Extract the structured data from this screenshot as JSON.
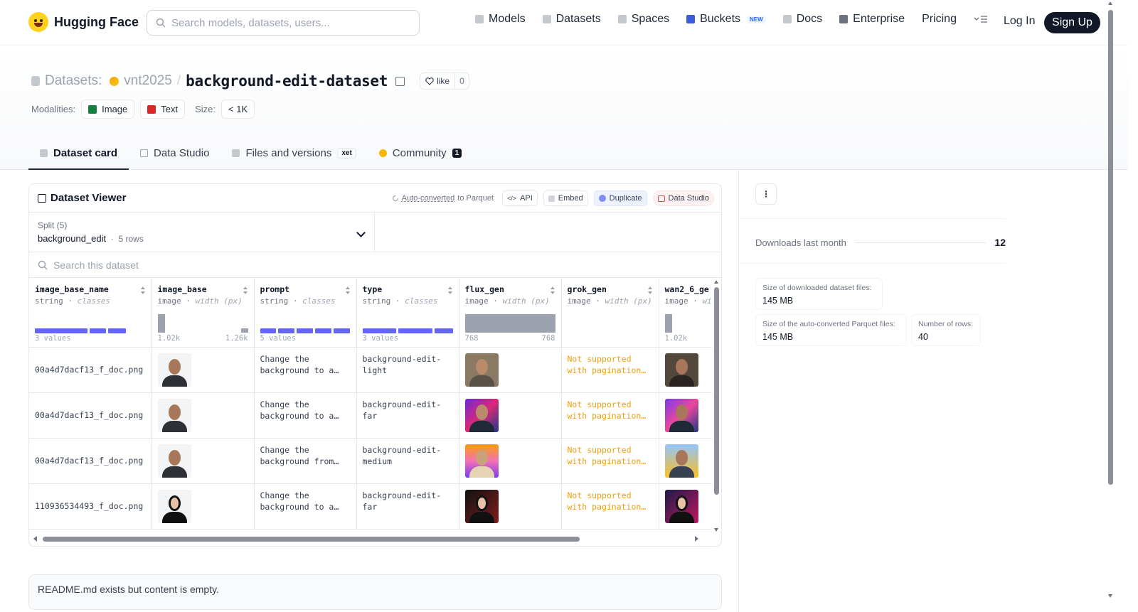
{
  "nav": {
    "brand": "Hugging Face",
    "search_placeholder": "Search models, datasets, users...",
    "links": [
      {
        "label": "Models",
        "icon": "cube-icon"
      },
      {
        "label": "Datasets",
        "icon": "database-icon"
      },
      {
        "label": "Spaces",
        "icon": "grid-icon"
      },
      {
        "label": "Buckets",
        "icon": "bucket-icon",
        "badge": "NEW"
      },
      {
        "label": "Docs",
        "icon": "book-icon"
      },
      {
        "label": "Enterprise",
        "icon": "enterprise-icon"
      },
      {
        "label": "Pricing"
      }
    ],
    "login": "Log In",
    "signup": "Sign Up"
  },
  "header": {
    "section": "Datasets:",
    "owner": "vnt2025",
    "separator": "/",
    "name": "background-edit-dataset",
    "like_label": "like",
    "like_count": "0",
    "modalities_label": "Modalities:",
    "modalities": [
      {
        "label": "Image",
        "color": "#15803d"
      },
      {
        "label": "Text",
        "color": "#dc2626"
      }
    ],
    "size_label": "Size:",
    "size_value": "< 1K",
    "tabs": [
      {
        "label": "Dataset card",
        "active": true
      },
      {
        "label": "Data Studio"
      },
      {
        "label": "Files and versions",
        "badge": "xet"
      },
      {
        "label": "Community",
        "count": "1"
      }
    ]
  },
  "viewer": {
    "title": "Dataset Viewer",
    "auto_converted_link": "Auto-converted",
    "auto_converted_rest": " to Parquet",
    "buttons": {
      "api": "API",
      "embed": "Embed",
      "duplicate": "Duplicate",
      "data_studio": "Data Studio"
    },
    "split_label": "Split (5)",
    "split_value": "background_edit",
    "split_rows": "5 rows",
    "search_placeholder": "Search this dataset",
    "columns": [
      {
        "name": "image_base_name",
        "type": "string",
        "kind": "classes",
        "hist_left": "3 values",
        "hist_right": ""
      },
      {
        "name": "image_base",
        "type": "image",
        "kind": "width (px)",
        "hist_left": "1.02k",
        "hist_right": "1.26k"
      },
      {
        "name": "prompt",
        "type": "string",
        "kind": "classes",
        "hist_left": "5 values",
        "hist_right": ""
      },
      {
        "name": "type",
        "type": "string",
        "kind": "classes",
        "hist_left": "3 values",
        "hist_right": ""
      },
      {
        "name": "flux_gen",
        "type": "image",
        "kind": "width (px)",
        "hist_left": "768",
        "hist_right": "768"
      },
      {
        "name": "grok_gen",
        "type": "image",
        "kind": "width (px)",
        "hist_left": "",
        "hist_right": ""
      },
      {
        "name": "wan2_6_ge",
        "type": "image",
        "kind": "wi",
        "hist_left": "1.02k",
        "hist_right": ""
      }
    ],
    "rows": [
      {
        "image_base_name": "00a4d7dacf13_f_doc.png",
        "prompt": "Change the background to a…",
        "type": "background-edit-light",
        "grok_gen": "Not supported with pagination…"
      },
      {
        "image_base_name": "00a4d7dacf13_f_doc.png",
        "prompt": "Change the background to a…",
        "type": "background-edit-far",
        "grok_gen": "Not supported with pagination…"
      },
      {
        "image_base_name": "00a4d7dacf13_f_doc.png",
        "prompt": "Change the background from…",
        "type": "background-edit-medium",
        "grok_gen": "Not supported with pagination…"
      },
      {
        "image_base_name": "110936534493_f_doc.png",
        "prompt": "Change the background to a…",
        "type": "background-edit-far",
        "grok_gen": "Not supported with pagination…"
      }
    ]
  },
  "readme_notice": "README.md exists but content is empty.",
  "sidebar": {
    "downloads_label": "Downloads last month",
    "downloads_value": "12",
    "stats": [
      {
        "label": "Size of downloaded dataset files:",
        "value": "145 MB"
      },
      {
        "label": "Size of the auto-converted Parquet files:",
        "value": "145 MB"
      },
      {
        "label": "Number of rows:",
        "value": "40"
      }
    ]
  },
  "colors": {
    "accent": "#6366f1",
    "warning": "#f59e0b",
    "dark": "#111827"
  }
}
